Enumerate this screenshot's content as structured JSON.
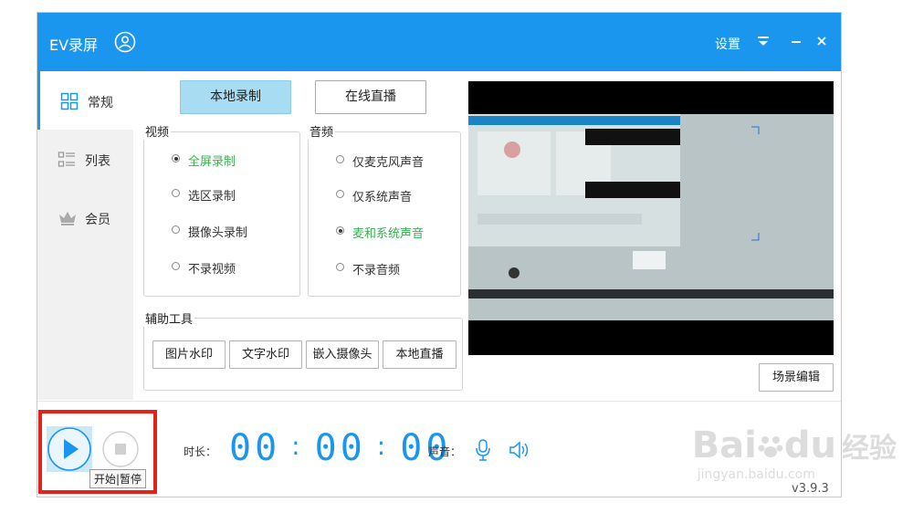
{
  "window": {
    "title": "EV录屏",
    "settings_label": "设置",
    "version": "v3.9.3"
  },
  "sidebar": {
    "items": [
      {
        "label": "常规",
        "icon": "grid-icon",
        "active": true
      },
      {
        "label": "列表",
        "icon": "list-icon",
        "active": false
      },
      {
        "label": "会员",
        "icon": "crown-icon",
        "active": false
      }
    ]
  },
  "mode_tabs": {
    "local_record": "本地录制",
    "live_stream": "在线直播"
  },
  "video": {
    "title": "视频",
    "options": [
      {
        "label": "全屏录制",
        "checked": true
      },
      {
        "label": "选区录制",
        "checked": false
      },
      {
        "label": "摄像头录制",
        "checked": false
      },
      {
        "label": "不录视频",
        "checked": false
      }
    ]
  },
  "audio": {
    "title": "音频",
    "options": [
      {
        "label": "仅麦克风声音",
        "checked": false
      },
      {
        "label": "仅系统声音",
        "checked": false
      },
      {
        "label": "麦和系统声音",
        "checked": true
      },
      {
        "label": "不录音频",
        "checked": false
      }
    ]
  },
  "tools": {
    "title": "辅助工具",
    "buttons": [
      "图片水印",
      "文字水印",
      "嵌入摄像头",
      "本地直播"
    ]
  },
  "scene_edit_label": "场景编辑",
  "bottom": {
    "duration_label": "时长：",
    "timer": {
      "hours": "00",
      "minutes": "00",
      "seconds": "00"
    },
    "sound_label": "声音：",
    "tooltip": "开始|暂停"
  },
  "watermark": {
    "brand": "Bai",
    "brand2": "du",
    "cn": "经验",
    "url": "jingyan.baidu.com"
  },
  "colors": {
    "titlebar": "#1a96ef",
    "accent": "#1a96ef",
    "checked_text": "#3aaf53",
    "highlight": "#e2231a"
  }
}
